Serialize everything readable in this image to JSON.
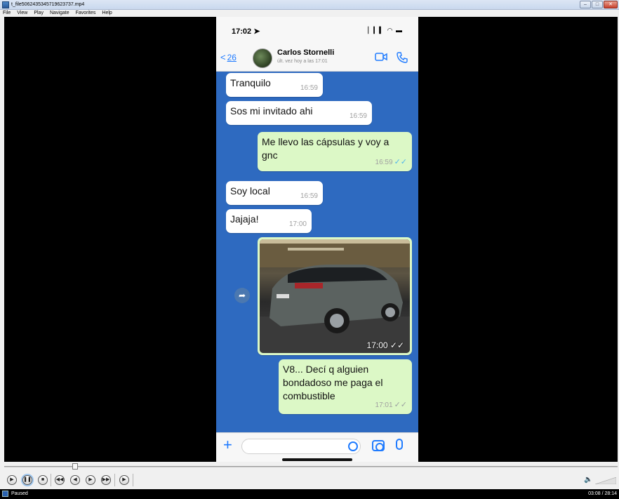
{
  "window": {
    "title": "t_file5062435345719623737.mp4",
    "controls": {
      "minimize": "–",
      "maximize": "□",
      "close": "✕"
    }
  },
  "menu": {
    "items": [
      "File",
      "View",
      "Play",
      "Navigate",
      "Favorites",
      "Help"
    ]
  },
  "phone": {
    "status_time": "17:02 ➤",
    "status_icons": "▏▎▍ ◠ ▬",
    "back_label": "<",
    "back_count": "26",
    "contact_name": "Carlos Stornelli",
    "contact_status": "últ. vez hoy a las 17:01",
    "video_icon": "video-call-icon",
    "phone_icon": "phone-call-icon"
  },
  "messages": [
    {
      "dir": "in",
      "text": "Tranquilo",
      "time": "16:59"
    },
    {
      "dir": "in",
      "text": "Sos mi invitado ahi",
      "time": "16:59"
    },
    {
      "dir": "out",
      "text": "Me llevo las cápsulas y voy a gnc",
      "time": "16:59",
      "ticks": "✓✓"
    },
    {
      "dir": "in",
      "text": "Soy local",
      "time": "16:59"
    },
    {
      "dir": "in",
      "text": "Jajaja!",
      "time": "17:00"
    },
    {
      "dir": "out",
      "text": "V8... Decí q alguien bondadoso me paga el combustible",
      "time": "17:01",
      "ticks": "✓✓"
    }
  ],
  "photo_message": {
    "time": "17:00",
    "ticks": "✓✓",
    "forward_icon": "➦"
  },
  "input_bar": {
    "plus": "+"
  },
  "player": {
    "status": "Paused",
    "time": "03:08 / 28:14",
    "progress_fraction": 0.112,
    "volume_icon": "🔈"
  },
  "colors": {
    "chat_bg": "#2e6ac0",
    "out_bubble": "#dcf8c6",
    "in_bubble": "#ffffff",
    "accent": "#1f7bff",
    "read_ticks": "#4fb6ec"
  }
}
